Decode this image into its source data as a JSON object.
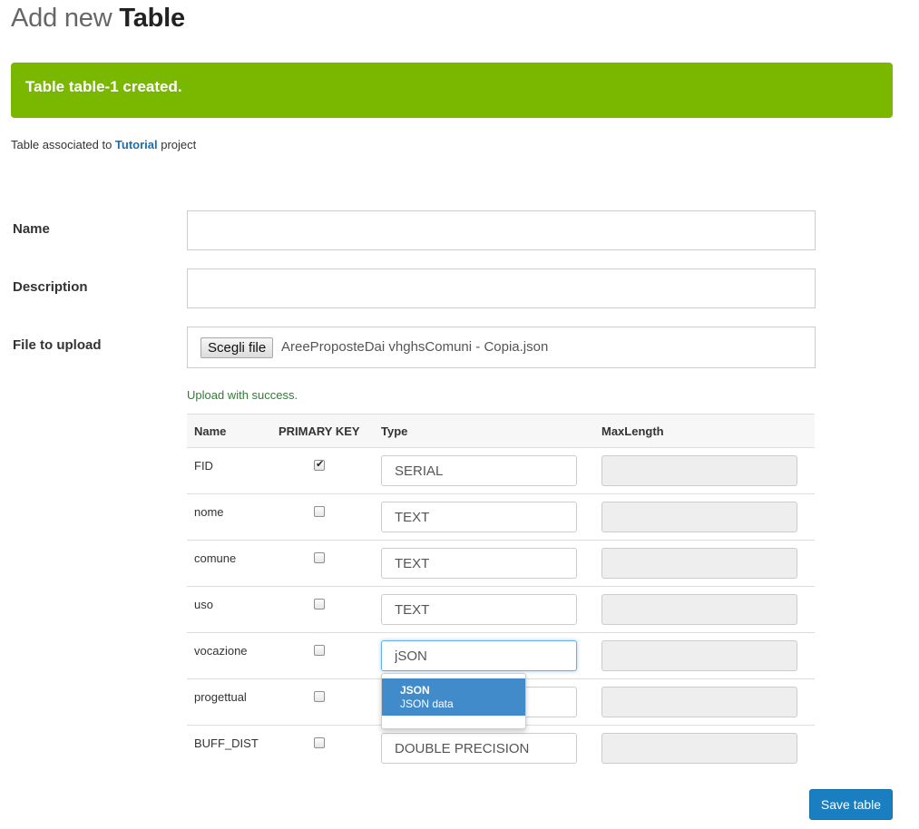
{
  "header": {
    "title_light": "Add new",
    "title_bold": "Table"
  },
  "alert": {
    "message": "Table table-1 created.",
    "color": "#7ab800"
  },
  "association": {
    "prefix": "Table associated to",
    "project": "Tutorial",
    "suffix": "project"
  },
  "form": {
    "name_label": "Name",
    "name_value": "",
    "description_label": "Description",
    "description_value": "",
    "file_label": "File to upload",
    "file_button": "Scegli file",
    "file_name": "AreeProposteDai vhghsComuni - Copia.json",
    "upload_message": "Upload with success."
  },
  "table": {
    "headers": {
      "name": "Name",
      "primary_key": "PRIMARY KEY",
      "type": "Type",
      "maxlength": "MaxLength"
    },
    "rows": [
      {
        "name": "FID",
        "primary_key": true,
        "type": "SERIAL"
      },
      {
        "name": "nome",
        "primary_key": false,
        "type": "TEXT"
      },
      {
        "name": "comune",
        "primary_key": false,
        "type": "TEXT"
      },
      {
        "name": "uso",
        "primary_key": false,
        "type": "TEXT"
      },
      {
        "name": "vocazione",
        "primary_key": false,
        "type": "jSON"
      },
      {
        "name": "progettual",
        "primary_key": false,
        "type": ""
      },
      {
        "name": "BUFF_DIST",
        "primary_key": false,
        "type": "DOUBLE PRECISION"
      }
    ]
  },
  "autocomplete": {
    "title": "JSON",
    "subtitle": "JSON data",
    "highlight_color": "#428bca"
  },
  "actions": {
    "save_label": "Save table",
    "accent_color": "#1a7fc1"
  }
}
